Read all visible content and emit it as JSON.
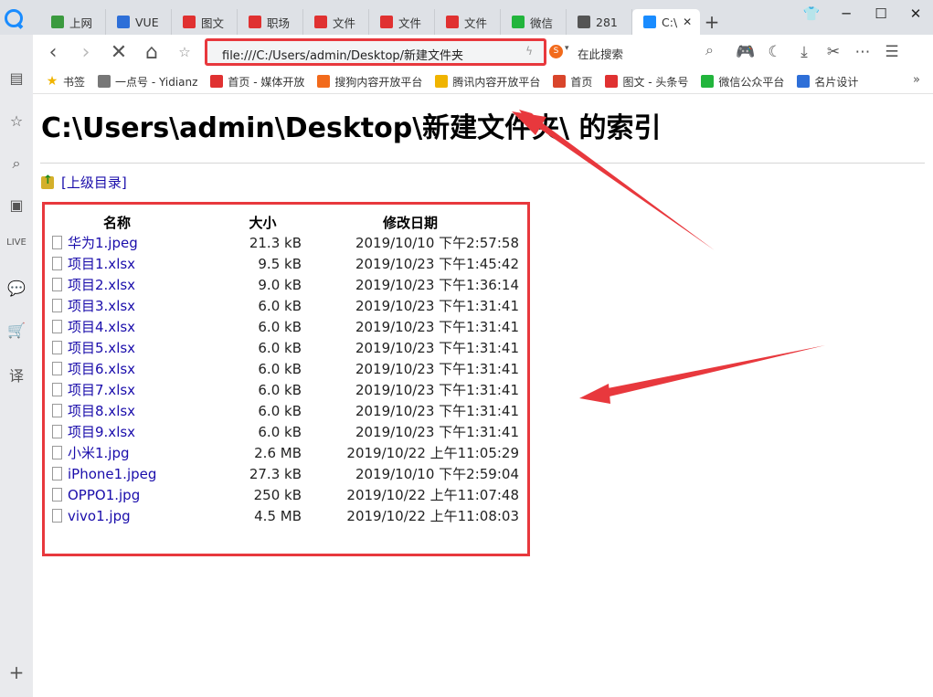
{
  "tabs": [
    {
      "label": "上网",
      "color": "#3b9a3f"
    },
    {
      "label": "VUE",
      "color": "#2e6fd8"
    },
    {
      "label": "图文",
      "color": "#e03131"
    },
    {
      "label": "职场",
      "color": "#e03131"
    },
    {
      "label": "文件",
      "color": "#e03131"
    },
    {
      "label": "文件",
      "color": "#e03131"
    },
    {
      "label": "文件",
      "color": "#e03131"
    },
    {
      "label": "微信",
      "color": "#22b53c"
    },
    {
      "label": "281",
      "color": "#555555"
    },
    {
      "label": "C:\\",
      "color": "#1a8cff"
    }
  ],
  "address": {
    "url": "file:///C:/Users/admin/Desktop/新建文件夹"
  },
  "search": {
    "placeholder": "在此搜索"
  },
  "bookmarks": [
    {
      "label": "书签",
      "color": "#f0b400"
    },
    {
      "label": "一点号 - Yidianz",
      "color": "#777777"
    },
    {
      "label": "首页 - 媒体开放",
      "color": "#e03131"
    },
    {
      "label": "搜狗内容开放平台",
      "color": "#f26a1b"
    },
    {
      "label": "腾讯内容开放平台",
      "color": "#f0b400"
    },
    {
      "label": "首页",
      "color": "#d9452b"
    },
    {
      "label": "图文 - 头条号",
      "color": "#e03131"
    },
    {
      "label": "微信公众平台",
      "color": "#22b53c"
    },
    {
      "label": "名片设计",
      "color": "#2e6fd8"
    }
  ],
  "page": {
    "heading": "C:\\Users\\admin\\Desktop\\新建文件夹\\ 的索引",
    "parent_link": "[上级目录]",
    "columns": {
      "name": "名称",
      "size": "大小",
      "date": "修改日期"
    },
    "files": [
      {
        "name": "华为1.jpeg",
        "size": "21.3 kB",
        "date": "2019/10/10 下午2:57:58"
      },
      {
        "name": "项目1.xlsx",
        "size": "9.5 kB",
        "date": "2019/10/23 下午1:45:42"
      },
      {
        "name": "项目2.xlsx",
        "size": "9.0 kB",
        "date": "2019/10/23 下午1:36:14"
      },
      {
        "name": "项目3.xlsx",
        "size": "6.0 kB",
        "date": "2019/10/23 下午1:31:41"
      },
      {
        "name": "项目4.xlsx",
        "size": "6.0 kB",
        "date": "2019/10/23 下午1:31:41"
      },
      {
        "name": "项目5.xlsx",
        "size": "6.0 kB",
        "date": "2019/10/23 下午1:31:41"
      },
      {
        "name": "项目6.xlsx",
        "size": "6.0 kB",
        "date": "2019/10/23 下午1:31:41"
      },
      {
        "name": "项目7.xlsx",
        "size": "6.0 kB",
        "date": "2019/10/23 下午1:31:41"
      },
      {
        "name": "项目8.xlsx",
        "size": "6.0 kB",
        "date": "2019/10/23 下午1:31:41"
      },
      {
        "name": "项目9.xlsx",
        "size": "6.0 kB",
        "date": "2019/10/23 下午1:31:41"
      },
      {
        "name": "小米1.jpg",
        "size": "2.6 MB",
        "date": "2019/10/22 上午11:05:29"
      },
      {
        "name": "iPhone1.jpeg",
        "size": "27.3 kB",
        "date": "2019/10/10 下午2:59:04"
      },
      {
        "name": "OPPO1.jpg",
        "size": "250 kB",
        "date": "2019/10/22 上午11:07:48"
      },
      {
        "name": "vivo1.jpg",
        "size": "4.5 MB",
        "date": "2019/10/22 上午11:08:03"
      }
    ]
  },
  "colors": {
    "highlight": "#e8383d",
    "link": "#1a0dab"
  }
}
